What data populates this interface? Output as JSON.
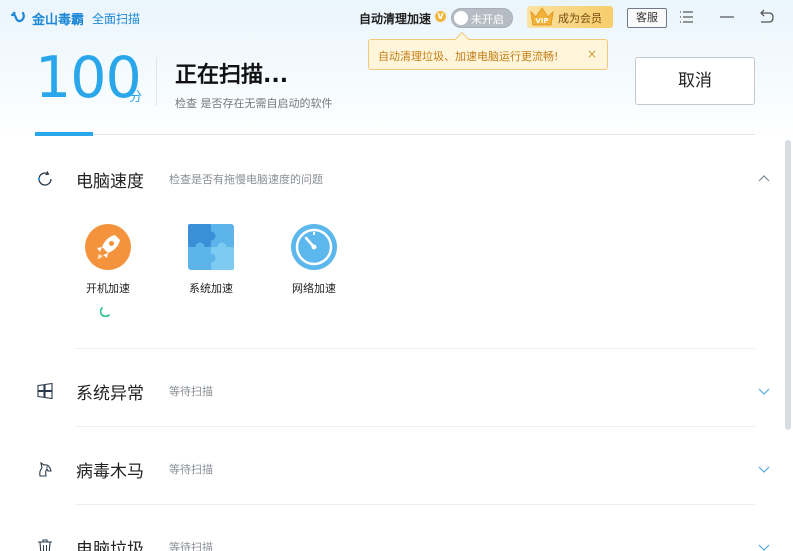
{
  "titlebar": {
    "app_name": "金山毒霸",
    "module": "全面扫描",
    "auto_clean_label": "自动清理加速",
    "v_badge": "V",
    "toggle_label": "未开启",
    "vip_badge": "VIP",
    "vip_label": "成为会员",
    "support_label": "客服"
  },
  "tooltip": {
    "text": "自动清理垃圾、加速电脑运行更流畅!",
    "close": "×"
  },
  "scan": {
    "score": "100",
    "score_unit": "分",
    "status_title": "正在扫描...",
    "status_detail": "检查 是否存在无需自启动的软件",
    "cancel_label": "取消",
    "progress": 0.08
  },
  "sections": [
    {
      "title": "电脑速度",
      "desc": "检查是否有拖慢电脑速度的问题",
      "icon": "refresh-icon",
      "expanded": true,
      "items": [
        {
          "label": "开机加速",
          "icon": "rocket-icon"
        },
        {
          "label": "系统加速",
          "icon": "puzzle-icon"
        },
        {
          "label": "网络加速",
          "icon": "speedometer-icon"
        }
      ]
    },
    {
      "title": "系统异常",
      "desc": "等待扫描",
      "icon": "windows-icon",
      "expanded": false
    },
    {
      "title": "病毒木马",
      "desc": "等待扫描",
      "icon": "horse-icon",
      "expanded": false
    },
    {
      "title": "电脑垃圾",
      "desc": "等待扫描",
      "icon": "trash-icon",
      "expanded": false
    }
  ],
  "colors": {
    "accent": "#2aa6ea",
    "brand": "#1e88d6",
    "tooltip_bg": "#fff5da",
    "spinner": "#27c28a"
  }
}
